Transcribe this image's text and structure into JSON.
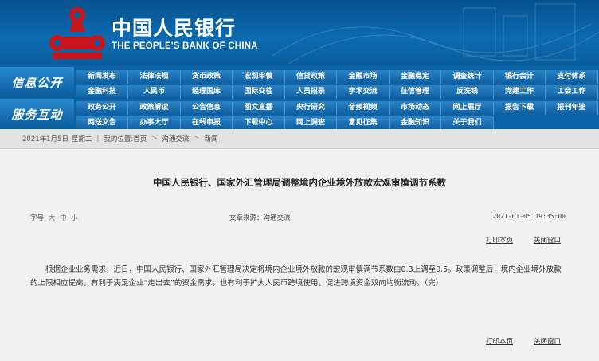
{
  "header": {
    "cn_name": "中国人民银行",
    "en_name": "THE PEOPLE'S BANK OF CHINA",
    "logo_icon": "pboc-logo-icon",
    "brand_red": "#c8161d"
  },
  "nav": {
    "info_label": "信息公开",
    "service_label": "服务互动",
    "row1": [
      "新闻发布",
      "法律法规",
      "货币政策",
      "宏观审慎",
      "信贷政策",
      "金融市场",
      "金融稳定",
      "调查统计",
      "银行会计",
      "支付体系"
    ],
    "row2": [
      "金融科技",
      "人民币",
      "经理国库",
      "国际交往",
      "人员招录",
      "学术交流",
      "征信管理",
      "反洗钱",
      "党建工作",
      "工会工作"
    ],
    "row3": [
      "政务公开",
      "政策解读",
      "公告信息",
      "图文直播",
      "央行研究",
      "音频视频",
      "市场动态",
      "网上展厅",
      "报告下载",
      "报刊年鉴"
    ],
    "row4": [
      "网送文告",
      "办事大厅",
      "在线申报",
      "下载中心",
      "网上调查",
      "意见征集",
      "金融知识",
      "关于我们"
    ]
  },
  "breadcrumb": {
    "date": "2021年1月5日",
    "weekday": "星期二",
    "position_label": "我的位置:",
    "home": "首页",
    "section": "沟通交流",
    "current": "新闻"
  },
  "article": {
    "title": "中国人民银行、国家外汇管理局调整境内企业境外放款宏观审慎调节系数",
    "font_size_label": "字号",
    "size_large": "大",
    "size_medium": "中",
    "size_small": "小",
    "source": "文章来源：沟通交流",
    "datetime": "2021-01-05 19:35:00",
    "print_label": "打印本页",
    "close_label": "关闭窗口",
    "body": "根据企业业务需求，近日，中国人民银行、国家外汇管理局决定将境内企业境外放款的宏观审慎调节系数由0.3上调至0.5。政策调整后，境内企业境外放款的上限相应提高，有利于满足企业“走出去”的资金需求，也有利于扩大人民币跨境使用，促进跨境资金双向均衡流动。（完）"
  }
}
